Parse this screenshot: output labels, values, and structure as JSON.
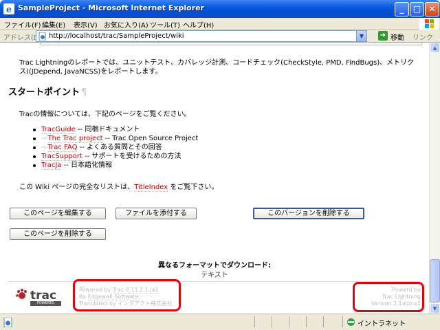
{
  "window": {
    "title": "SampleProject - Microsoft Internet Explorer",
    "min_label": "_",
    "max_label": "□",
    "close_label": "✕"
  },
  "menu": {
    "items": [
      "ファイル(F)",
      "編集(E)",
      "表示(V)",
      "お気に入り(A)",
      "ツール(T)",
      "ヘルプ(H)"
    ]
  },
  "address": {
    "label": "アドレス(D)",
    "url": "http://localhost/trac/SampleProject/wiki",
    "go_label": "移動",
    "links_label": "リンク"
  },
  "content": {
    "intro": "Trac Lightningのレポートでは、ユニットテスト、カバレッジ計測、コードチェック(CheckStyle, PMD, FindBugs)、メトリクス((JDepend, JavaNCSS)をレポートします。",
    "heading": "スタートポイント",
    "heading_anchor": "¶",
    "para1": "Tracの情報については、下記のページをご覧ください。",
    "links": [
      {
        "text": "TracGuide",
        "desc": " -- 同梱ドキュメント",
        "external": false
      },
      {
        "text": "The Trac project",
        "desc": " -- Trac Open Source Project",
        "external": true
      },
      {
        "text": "Trac FAQ",
        "desc": " -- よくある質問とその回答",
        "external": true
      },
      {
        "text": "TracSupport",
        "desc": " -- サポートを受けるための方法",
        "external": false
      },
      {
        "text": "TracJa",
        "desc": " -- 日本語化情報",
        "external": false
      }
    ],
    "para2_before": "この Wiki ページの完全なリストは、",
    "para2_link": "TitleIndex",
    "para2_after": " をご覧下さい。"
  },
  "buttons": {
    "edit": "このページを編集する",
    "attach": "ファイルを添付する",
    "delete_version": "このバージョンを削除する",
    "delete_page": "このページを削除する"
  },
  "download": {
    "title": "異なるフォーマットでダウンロード:",
    "text_format": "テキスト"
  },
  "footer": {
    "logo_text": "trac",
    "logo_sub": "POWERED",
    "powered_prefix": "Powered by ",
    "powered_product": "Trac 0.11.2.1.ja1",
    "by_prefix": "By ",
    "by_link": "Edgewall Software.",
    "translated": "Translated by インタアクト株式会社",
    "right_line1": "Powerd by",
    "right_line2": "Trac Lightning",
    "right_line3": "Version 2.1alpha1"
  },
  "status": {
    "zone": "イントラネット"
  }
}
